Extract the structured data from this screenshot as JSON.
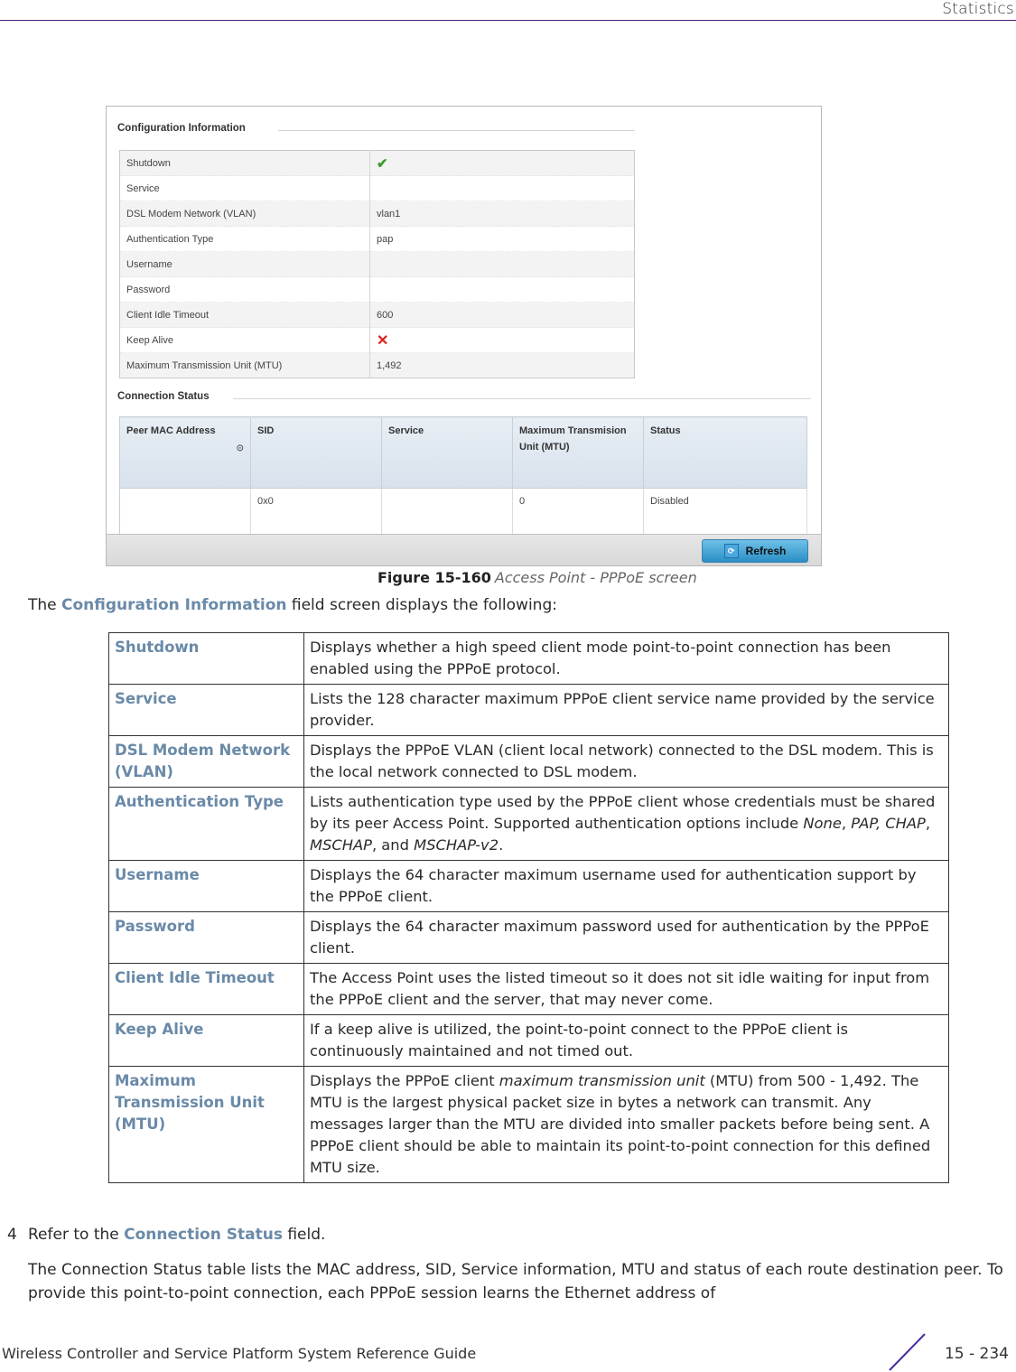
{
  "header": {
    "section_title": "Statistics"
  },
  "figure": {
    "config_section_title": "Configuration Information",
    "config_rows": [
      {
        "label": "Shutdown",
        "value": "",
        "icon": "check-icon"
      },
      {
        "label": "Service",
        "value": ""
      },
      {
        "label": "DSL Modem Network (VLAN)",
        "value": "vlan1"
      },
      {
        "label": "Authentication Type",
        "value": "pap"
      },
      {
        "label": "Username",
        "value": ""
      },
      {
        "label": "Password",
        "value": ""
      },
      {
        "label": "Client Idle Timeout",
        "value": "600"
      },
      {
        "label": "Keep Alive",
        "value": "",
        "icon": "x-icon"
      },
      {
        "label": "Maximum Transmission Unit (MTU)",
        "value": "1,492"
      }
    ],
    "icons": {
      "check": "✔",
      "cross": "✕",
      "sort": "⊙",
      "refresh": "⟳"
    },
    "status_section_title": "Connection Status",
    "status_columns": [
      "Peer MAC Address",
      "SID",
      "Service",
      "Maximum Transmision Unit (MTU)",
      "Status"
    ],
    "status_rows": [
      [
        "",
        "0x0",
        "",
        "0",
        "Disabled"
      ]
    ],
    "refresh_label": "Refresh",
    "colors": {
      "check": "#3a9b2a",
      "cross": "#e02020",
      "button": "#2a8fc6"
    }
  },
  "caption": {
    "number": "Figure 15-160",
    "text": "Access Point - PPPoE screen"
  },
  "intro": {
    "pre": "The ",
    "highlight": "Configuration Information",
    "post": " field screen displays the following:"
  },
  "descriptions": [
    {
      "term": "Shutdown",
      "text": "Displays whether a high speed client mode point-to-point connection has been enabled using the PPPoE protocol."
    },
    {
      "term": "Service",
      "text": "Lists the 128 character maximum PPPoE client service name provided by the service provider."
    },
    {
      "term": "DSL Modem Network (VLAN)",
      "text": "Displays the PPPoE VLAN (client local network) connected to the DSL modem. This is the local network connected to DSL modem."
    },
    {
      "term": "Authentication Type",
      "text_pre": "Lists authentication type used by the PPPoE client whose credentials must be shared by its peer Access Point. Supported authentication options include ",
      "options": [
        "None",
        "PAP, CHAP",
        "MSCHAP",
        "MSCHAP-v2"
      ],
      "text_post": "."
    },
    {
      "term": "Username",
      "text": "Displays the 64 character maximum username used for authentication support by the PPPoE client."
    },
    {
      "term": "Password",
      "text": "Displays the 64 character maximum password used for authentication by the PPPoE client."
    },
    {
      "term": "Client Idle Timeout",
      "text": "The Access Point uses the listed timeout so it does not sit idle waiting for input from the PPPoE client and the server, that may never come."
    },
    {
      "term": "Keep Alive",
      "text": "If a keep alive is utilized, the point-to-point connect to the PPPoE client is continuously maintained and not timed out."
    },
    {
      "term": "Maximum Transmission Unit (MTU)",
      "text_pre": "Displays the PPPoE client ",
      "italic": "maximum transmission unit",
      "text_post": " (MTU) from 500 - 1,492. The MTU is the largest physical packet size in bytes a network can transmit. Any messages larger than the MTU are divided into smaller packets before being sent. A PPPoE client should be able to maintain its point-to-point connection for this defined MTU size."
    }
  ],
  "step": {
    "number": "4",
    "pre": "Refer to the ",
    "highlight": "Connection Status",
    "post": " field."
  },
  "paragraph": "The Connection Status table lists the MAC address, SID, Service information, MTU and status of each route destination peer. To provide this point-to-point connection, each PPPoE session learns the Ethernet address of",
  "footer": {
    "guide_title": "Wireless Controller and Service Platform System Reference Guide",
    "page": "15 - 234"
  },
  "theme": {
    "accent": "#4b1c7a",
    "term_color": "#6a8aa8"
  }
}
